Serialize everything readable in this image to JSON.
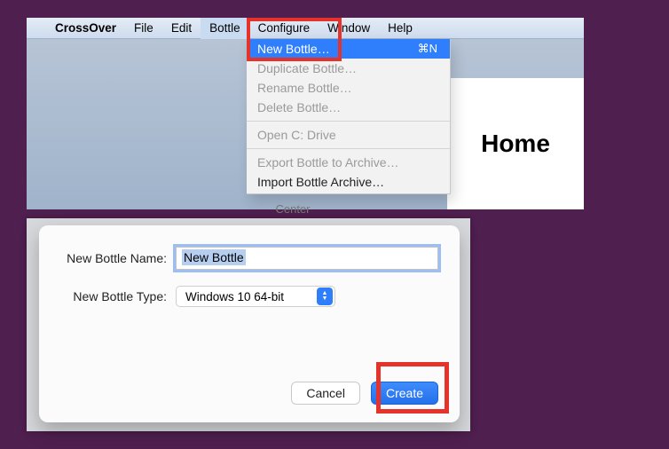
{
  "menubar": {
    "app_name": "CrossOver",
    "items": [
      "File",
      "Edit",
      "Bottle",
      "Configure",
      "Window",
      "Help"
    ],
    "open_index": 2
  },
  "bottle_menu": {
    "items": [
      {
        "label": "New Bottle…",
        "shortcut": "⌘N",
        "enabled": true,
        "selected": true
      },
      {
        "label": "Duplicate Bottle…",
        "enabled": false
      },
      {
        "label": "Rename Bottle…",
        "enabled": false
      },
      {
        "label": "Delete Bottle…",
        "enabled": false
      },
      {
        "sep": true
      },
      {
        "label": "Open C: Drive",
        "enabled": false
      },
      {
        "sep": true
      },
      {
        "label": "Export Bottle to Archive…",
        "enabled": false
      },
      {
        "label": "Import Bottle Archive…",
        "enabled": true
      }
    ]
  },
  "home_panel": {
    "title": "Home"
  },
  "partial_text": "Center",
  "dialog": {
    "name_label": "New Bottle Name:",
    "name_value": "New Bottle",
    "type_label": "New Bottle Type:",
    "type_value": "Windows 10 64-bit",
    "cancel": "Cancel",
    "create": "Create"
  },
  "colors": {
    "page_bg": "#4f1f4f",
    "accent": "#2f7efc",
    "highlight": "#e5322b"
  }
}
